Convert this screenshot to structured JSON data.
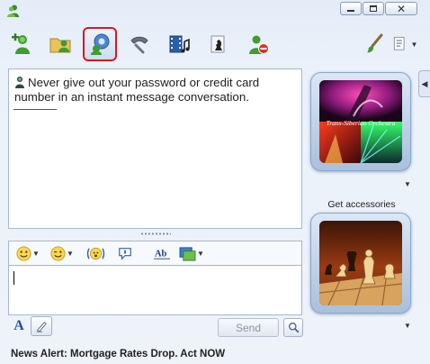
{
  "window": {
    "minimize_icon": "minimize-icon",
    "maximize_icon": "maximize-icon",
    "close_icon": "close-icon"
  },
  "toolbar": {
    "items": [
      {
        "name": "invite-contact",
        "icon": "add-contact-icon"
      },
      {
        "name": "send-files",
        "icon": "folder-share-icon"
      },
      {
        "name": "start-voice",
        "icon": "webcam-voice-icon",
        "highlighted": true
      },
      {
        "name": "call",
        "icon": "phone-handset-icon"
      },
      {
        "name": "video-activities",
        "icon": "film-music-icon"
      },
      {
        "name": "games",
        "icon": "chess-piece-icon"
      },
      {
        "name": "block",
        "icon": "block-contact-icon"
      },
      {
        "name": "change-background",
        "icon": "paintbrush-icon"
      },
      {
        "name": "show-menu",
        "icon": "menu-icon"
      }
    ],
    "highlight_color": "#d21c1c"
  },
  "history": {
    "warning_text": "Never give out your password or credit card number in an instant message conversation.",
    "warning_icon": "user-warning-icon"
  },
  "compose_toolbar": {
    "items": [
      "emoticon-icon",
      "wink-icon",
      "nudge-icon",
      "voice-clip-icon",
      "spell-check-icon",
      "background-picture-icon"
    ]
  },
  "compose": {
    "value": "",
    "font_label": "A",
    "send_label": "Send"
  },
  "contact_card": {
    "picture_caption": "Trans-Siberian Orchestra",
    "accessories_label": "Get accessories"
  },
  "news": {
    "text": "News Alert: Mortgage Rates Drop. Act NOW"
  },
  "colors": {
    "frame": "#a6b7cf",
    "window_bg": "#e3ecf7",
    "link": "#2251a8"
  }
}
